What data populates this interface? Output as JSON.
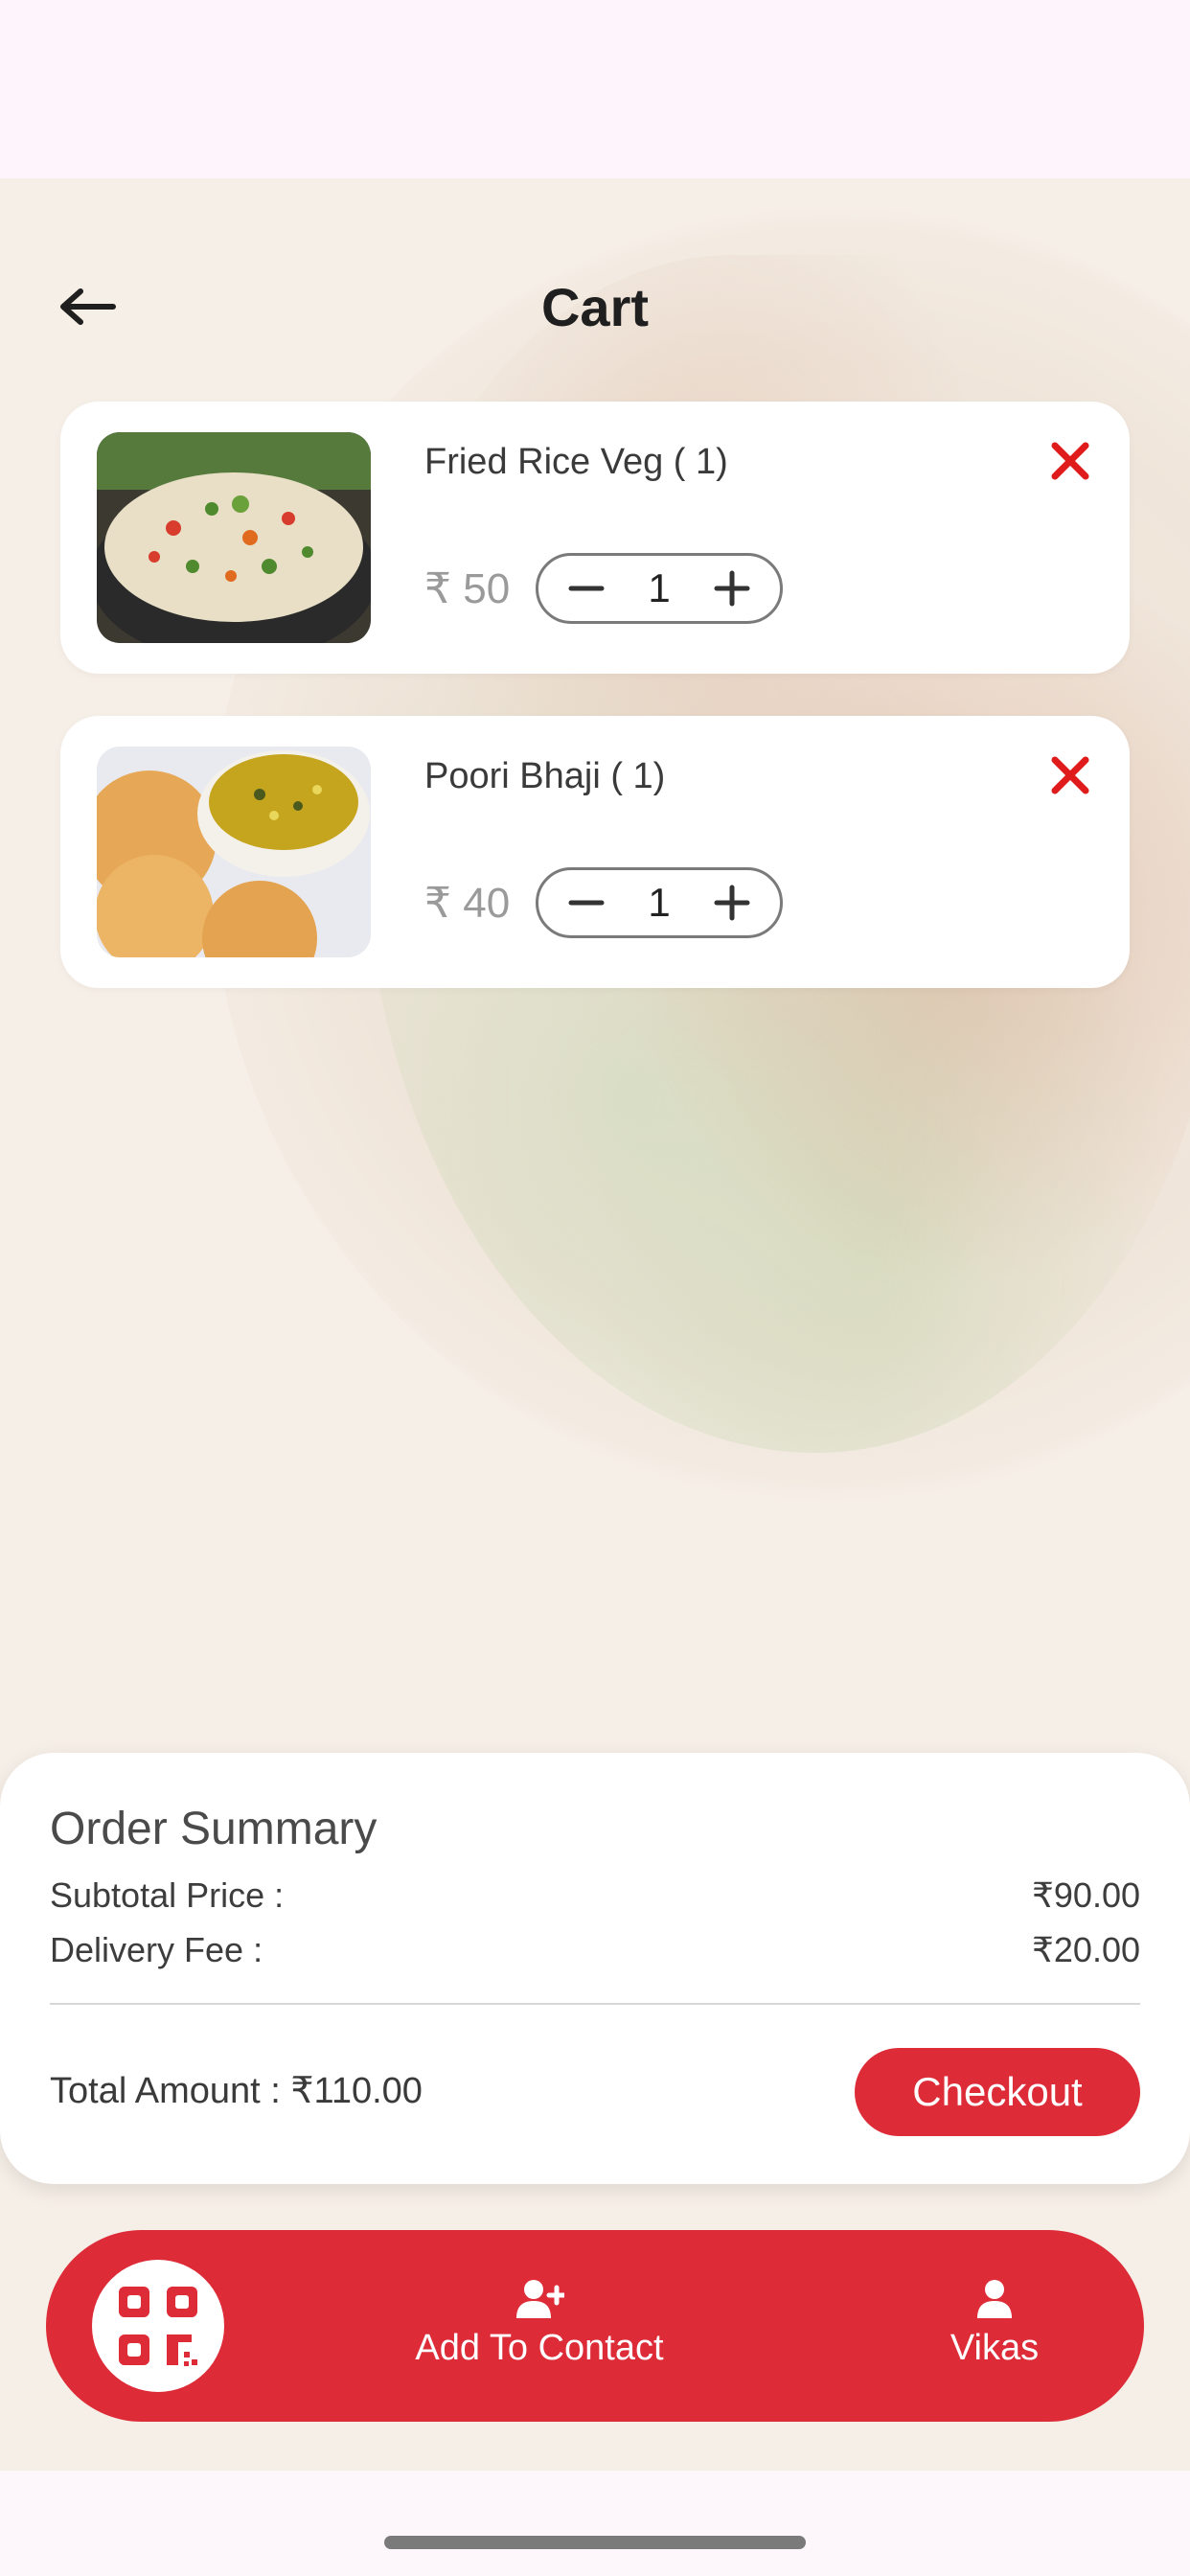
{
  "header": {
    "title": "Cart"
  },
  "cart": {
    "items": [
      {
        "name": "Fried Rice Veg ( 1)",
        "price": "₹ 50",
        "quantity": "1",
        "image": "fried-rice-photo"
      },
      {
        "name": "Poori Bhaji ( 1)",
        "price": "₹ 40",
        "quantity": "1",
        "image": "poori-bhaji-photo"
      }
    ]
  },
  "summary": {
    "title": "Order Summary",
    "subtotal_label": "Subtotal Price :",
    "subtotal_value": "₹90.00",
    "delivery_label": "Delivery Fee :",
    "delivery_value": "₹20.00",
    "total": "Total Amount : ₹110.00",
    "checkout_label": "Checkout"
  },
  "bottom_nav": {
    "qr_icon": "qr-code-icon",
    "contact_label": "Add To Contact",
    "contact_icon": "add-user-icon",
    "profile_label": "Vikas",
    "profile_icon": "user-icon"
  },
  "colors": {
    "accent": "#dd2b37",
    "remove": "#e01b1b",
    "background": "#f6efe7"
  }
}
